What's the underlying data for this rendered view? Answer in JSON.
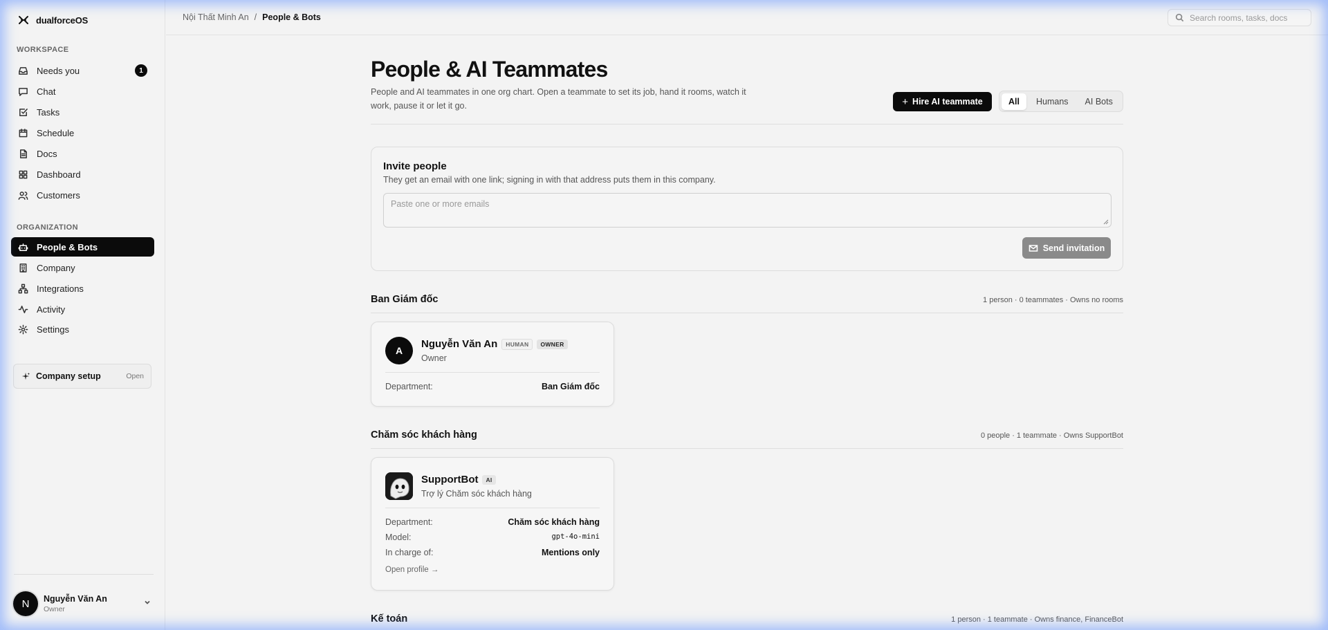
{
  "app": {
    "name": "dualforceOS"
  },
  "sidebar": {
    "workspace_label": "WORKSPACE",
    "workspace_items": [
      {
        "label": "Needs you",
        "icon": "inbox-icon",
        "badge": "1"
      },
      {
        "label": "Chat",
        "icon": "chat-icon"
      },
      {
        "label": "Tasks",
        "icon": "tasks-icon"
      },
      {
        "label": "Schedule",
        "icon": "calendar-icon"
      },
      {
        "label": "Docs",
        "icon": "document-icon"
      },
      {
        "label": "Dashboard",
        "icon": "dashboard-icon"
      },
      {
        "label": "Customers",
        "icon": "customers-icon"
      }
    ],
    "organization_label": "ORGANIZATION",
    "organization_items": [
      {
        "label": "People & Bots",
        "icon": "bot-icon",
        "active": true
      },
      {
        "label": "Company",
        "icon": "building-icon"
      },
      {
        "label": "Integrations",
        "icon": "integrations-icon"
      },
      {
        "label": "Activity",
        "icon": "activity-icon"
      },
      {
        "label": "Settings",
        "icon": "settings-icon"
      }
    ],
    "setup": {
      "label": "Company setup",
      "action": "Open"
    },
    "user": {
      "initial": "N",
      "name": "Nguyễn Văn An",
      "role": "Owner"
    }
  },
  "topbar": {
    "breadcrumb": [
      "Nội Thất Minh An",
      "/",
      "People & Bots"
    ],
    "search_placeholder": "Search rooms, tasks, docs"
  },
  "page": {
    "title": "People & AI Teammates",
    "description": "People and AI teammates in one org chart. Open a teammate to set its job, hand it rooms, watch it work, pause it or let it go.",
    "hire_label": "Hire AI teammate",
    "filters": [
      "All",
      "Humans",
      "AI Bots"
    ],
    "active_filter": "All"
  },
  "invite": {
    "title": "Invite people",
    "subtitle": "They get an email with one link; signing in with that address puts them in this company.",
    "placeholder": "Paste one or more emails",
    "send_label": "Send invitation"
  },
  "departments": [
    {
      "name": "Ban Giám đốc",
      "meta": "1 person · 0 teammates · Owns no rooms",
      "member": {
        "initial": "A",
        "name": "Nguyễn Văn An",
        "tags": [
          "HUMAN",
          "OWNER"
        ],
        "role": "Owner",
        "department_label": "Department:",
        "department": "Ban Giám đốc"
      }
    },
    {
      "name": "Chăm sóc khách hàng",
      "meta": "0 people · 1 teammate · Owns SupportBot",
      "member": {
        "name": "SupportBot",
        "tags": [
          "AI"
        ],
        "role": "Trợ lý Chăm sóc khách hàng",
        "department_label": "Department:",
        "department": "Chăm sóc khách hàng",
        "model_label": "Model:",
        "model": "gpt-4o-mini",
        "charge_label": "In charge of:",
        "charge": "Mentions only",
        "profile_link": "Open profile →"
      }
    },
    {
      "name": "Kế toán",
      "meta": "1 person · 1 teammate · Owns finance, FinanceBot"
    }
  ]
}
